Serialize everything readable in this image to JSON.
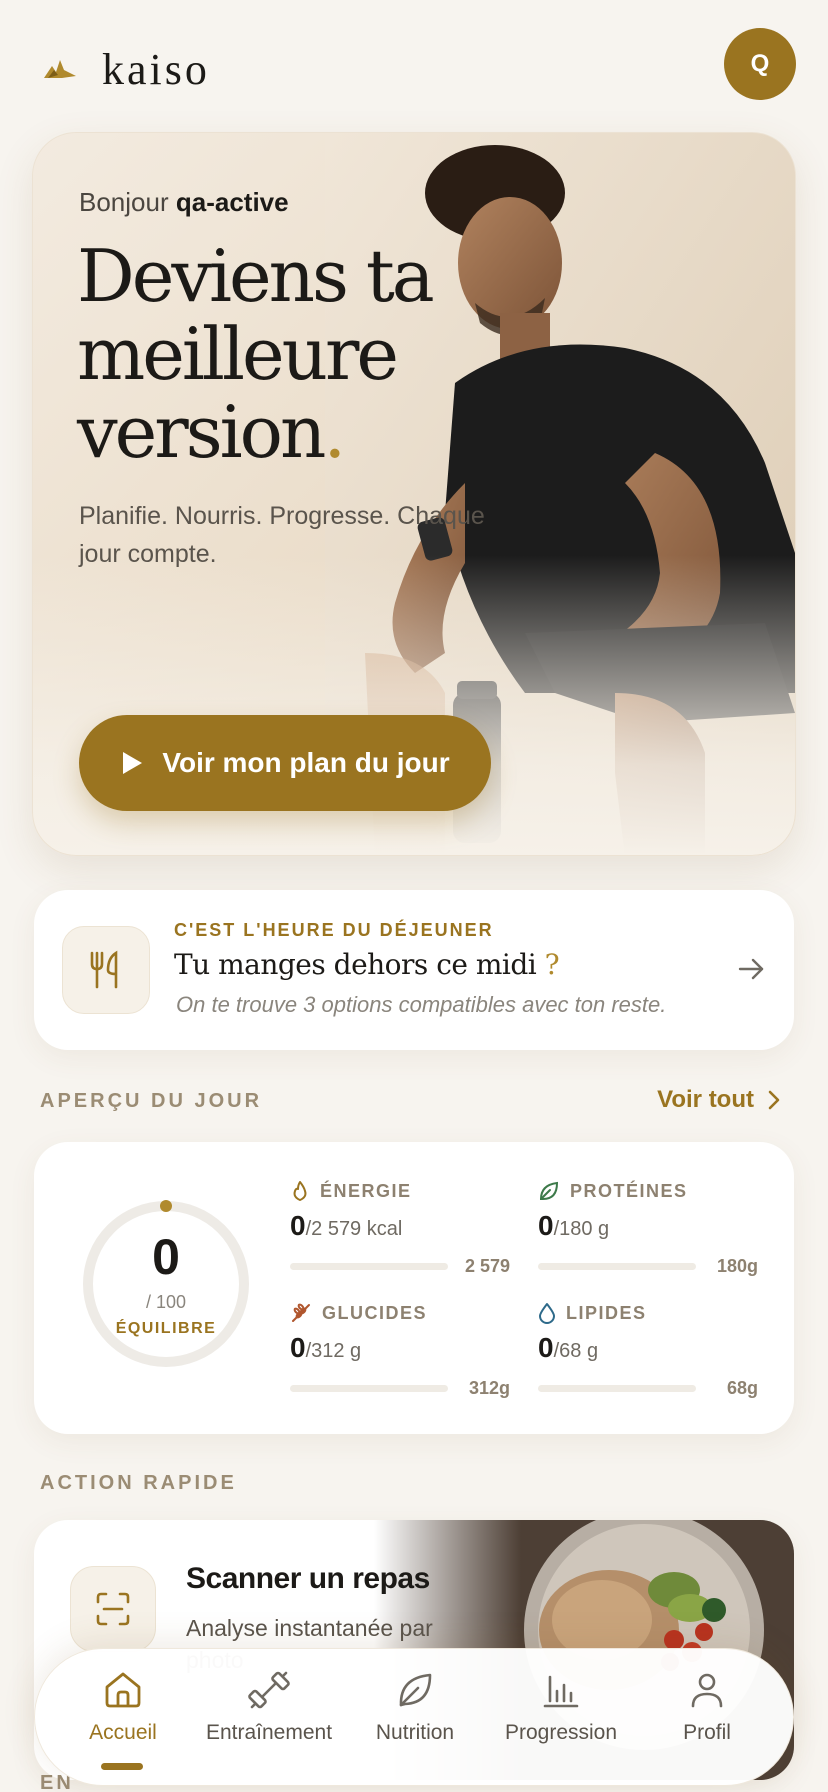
{
  "header": {
    "brand": "kaiso",
    "avatar_initial": "Q"
  },
  "hero": {
    "greeting_prefix": "Bonjour",
    "username": "qa-active",
    "title_line1": "Deviens ta",
    "title_line2": "meilleure",
    "title_line3": "version",
    "title_dot": ".",
    "subtitle": "Planifie. Nourris. Progresse. Chaque jour compte.",
    "cta_label": "Voir mon plan du jour"
  },
  "lunch": {
    "kicker": "C'EST L'HEURE DU DÉJEUNER",
    "title": "Tu manges dehors ce midi",
    "title_mark": "?",
    "description": "On te trouve 3 options compatibles avec ton reste."
  },
  "overview": {
    "section_label": "APERÇU DU JOUR",
    "see_all": "Voir tout",
    "score": {
      "value": "0",
      "max": "/ 100",
      "status": "ÉQUILIBRE",
      "progress": 0
    },
    "macros": [
      {
        "label": "ÉNERGIE",
        "value": "0",
        "of": "/2 579 kcal",
        "target": "2 579",
        "progress": 0,
        "icon": "flame-icon",
        "color": "#9a7420"
      },
      {
        "label": "PROTÉINES",
        "value": "0",
        "of": "/180 g",
        "target": "180g",
        "progress": 0,
        "icon": "leaf-icon",
        "color": "#3d7a4a"
      },
      {
        "label": "GLUCIDES",
        "value": "0",
        "of": "/312 g",
        "target": "312g",
        "progress": 0,
        "icon": "wheat-icon",
        "color": "#b0562e"
      },
      {
        "label": "LIPIDES",
        "value": "0",
        "of": "/68 g",
        "target": "68g",
        "progress": 0,
        "icon": "drop-icon",
        "color": "#2e6a8a"
      }
    ]
  },
  "quick_action": {
    "section_label": "ACTION RAPIDE",
    "title": "Scanner un repas",
    "description": "Analyse instantanée par photo"
  },
  "next_section_label": "EN",
  "nav": {
    "items": [
      {
        "label": "Accueil",
        "icon": "home-icon",
        "active": true
      },
      {
        "label": "Entraînement",
        "icon": "dumbbell-icon",
        "active": false
      },
      {
        "label": "Nutrition",
        "icon": "leaf-icon",
        "active": false
      },
      {
        "label": "Progression",
        "icon": "bar-chart-icon",
        "active": false
      },
      {
        "label": "Profil",
        "icon": "user-icon",
        "active": false
      }
    ]
  },
  "colors": {
    "accent": "#9a7420",
    "background": "#f7f4ef"
  }
}
